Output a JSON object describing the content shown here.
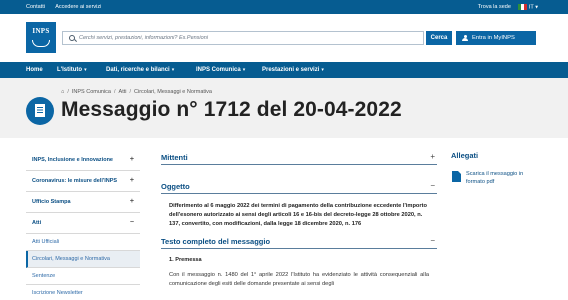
{
  "topbar": {
    "links": [
      "Contatti",
      "Accedere ai servizi"
    ],
    "trova_sede": "Trova la sede",
    "language": "IT"
  },
  "header": {
    "logo_text": "INPS",
    "search_placeholder": "Cerchi servizi, prestazioni, informazioni? Es.Pensioni",
    "search_button": "Cerca",
    "mynps_button": "Entra in MyINPS"
  },
  "nav": {
    "items": [
      "Home",
      "L'Istituto",
      "Dati, ricerche e bilanci",
      "INPS Comunica",
      "Prestazioni e servizi"
    ]
  },
  "breadcrumb": [
    "INPS Comunica",
    "Atti",
    "Circolari, Messaggi e Normativa"
  ],
  "page": {
    "title": "Messaggio n° 1712 del 20-04-2022"
  },
  "sidebar": {
    "items": [
      {
        "label": "INPS, Inclusione e Innovazione"
      },
      {
        "label": "Coronavirus: le misure dell'INPS"
      },
      {
        "label": "Ufficio Stampa"
      },
      {
        "label": "Atti"
      }
    ],
    "subitems": [
      {
        "label": "Atti Ufficiali"
      },
      {
        "label": "Circolari, Messaggi e Normativa"
      },
      {
        "label": "Sentenze"
      },
      {
        "label": "Iscrizione Newsletter"
      }
    ]
  },
  "main": {
    "mittenti": "Mittenti",
    "oggetto": "Oggetto",
    "oggetto_text": "Differimento al 6 maggio 2022 dei termini di pagamento della contribuzione eccedente l'importo dell'esonero autorizzato ai sensi degli articoli 16 e 16-bis del decreto-legge 28 ottobre 2020, n. 137, convertito, con modificazioni, dalla legge 18 dicembre 2020, n. 176",
    "testo": "Testo completo del messaggio",
    "premessa_head": "1. Premessa",
    "premessa_text": "Con il messaggio n. 1480 del 1° aprile 2022 l'Istituto ha evidenziato le attività consequenziali alla comunicazione degli esiti delle domande presentate ai sensi degli"
  },
  "allegati": {
    "title": "Allegati",
    "item": "Scarica il messaggio in formato pdf"
  }
}
